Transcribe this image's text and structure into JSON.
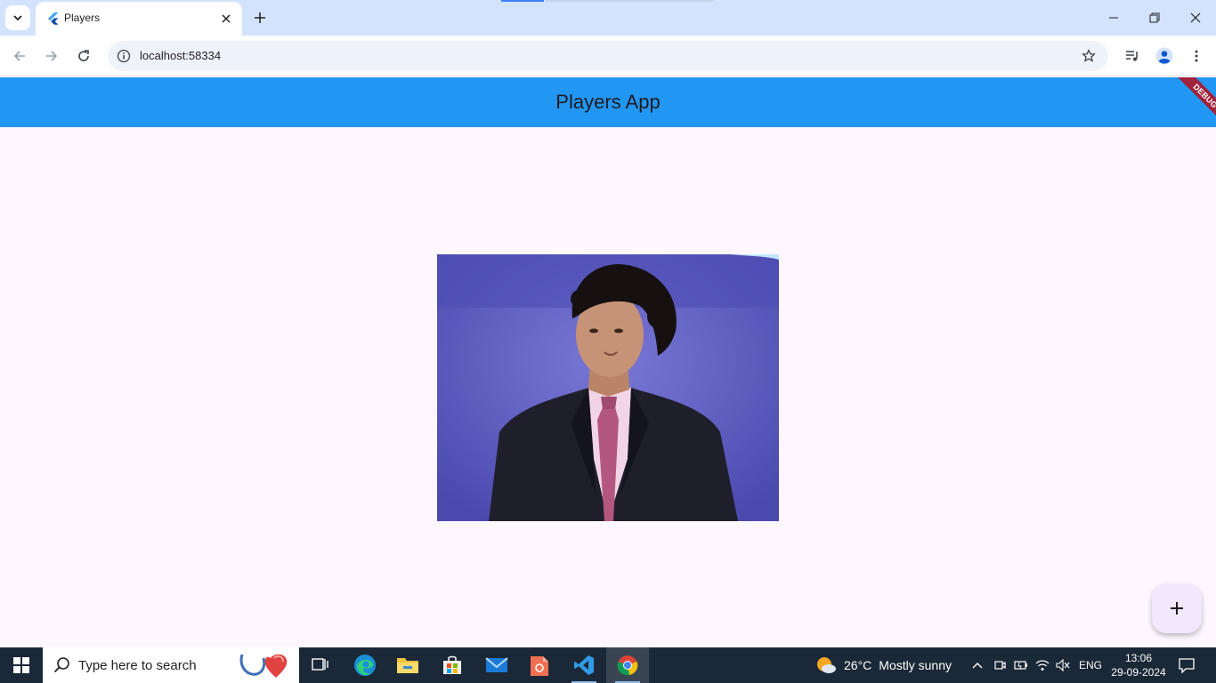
{
  "browser": {
    "tab_title": "Players",
    "url": "localhost:58334"
  },
  "app": {
    "title": "Players App",
    "debug_label": "DEBUG",
    "colors": {
      "appbar": "#2196f3",
      "background": "#fef7ff",
      "fab": "#f1e8fb",
      "debug_ribbon": "#a0233d"
    },
    "player_image": "portrait of player in dark suit and pink tie against purple background",
    "fab_icon": "plus-icon"
  },
  "taskbar": {
    "search_placeholder": "Type here to search",
    "weather_temp": "26°C",
    "weather_desc": "Mostly sunny",
    "language": "ENG",
    "time": "13:06",
    "date": "29-09-2024"
  }
}
